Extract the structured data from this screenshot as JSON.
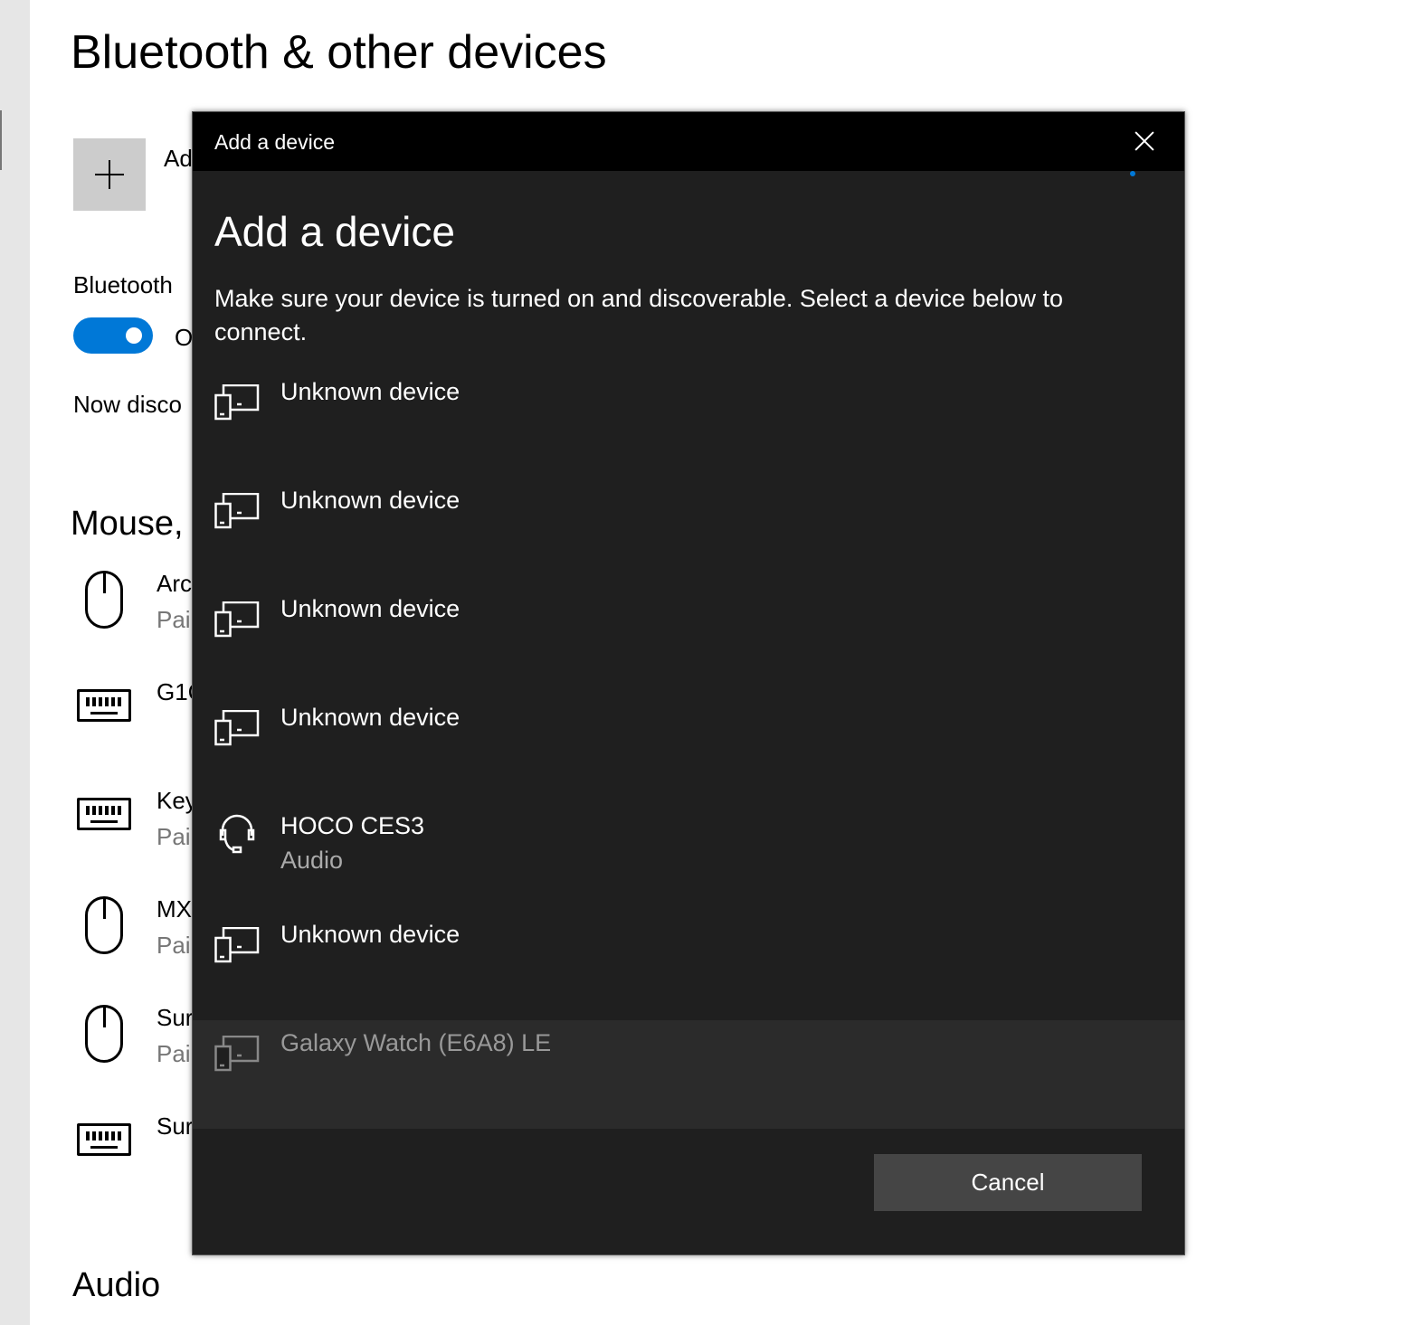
{
  "background": {
    "title": "Bluetooth & other devices",
    "add_label_fragment": "Ad",
    "bluetooth_label": "Bluetooth",
    "toggle_state": "on",
    "toggle_label_fragment": "O",
    "discoverable_fragment": "Now disco",
    "section_mouse_fragment": "Mouse,",
    "items": [
      {
        "icon": "mouse-icon",
        "name": "Arc",
        "status": "Pai"
      },
      {
        "icon": "keyboard-icon",
        "name": "G1C",
        "status": ""
      },
      {
        "icon": "keyboard-icon",
        "name": "Key",
        "status": "Pai"
      },
      {
        "icon": "mouse-icon",
        "name": "MX",
        "status": "Pai"
      },
      {
        "icon": "mouse-icon",
        "name": "Sur",
        "status": "Pai"
      },
      {
        "icon": "keyboard-icon",
        "name": "Sur",
        "status": ""
      }
    ],
    "section_audio": "Audio"
  },
  "dialog": {
    "window_title": "Add a device",
    "heading": "Add a device",
    "description": "Make sure your device is turned on and discoverable. Select a device below to connect.",
    "devices": [
      {
        "icon": "devices-icon",
        "name": "Unknown device",
        "sub": ""
      },
      {
        "icon": "devices-icon",
        "name": "Unknown device",
        "sub": ""
      },
      {
        "icon": "devices-icon",
        "name": "Unknown device",
        "sub": ""
      },
      {
        "icon": "devices-icon",
        "name": "Unknown device",
        "sub": ""
      },
      {
        "icon": "headset-icon",
        "name": "HOCO CES3",
        "sub": "Audio"
      },
      {
        "icon": "devices-icon",
        "name": "Unknown device",
        "sub": ""
      },
      {
        "icon": "devices-icon",
        "name": "Galaxy Watch (E6A8) LE",
        "sub": "",
        "selected": true
      }
    ],
    "cancel_label": "Cancel"
  },
  "colors": {
    "accent": "#0078d7",
    "dialog_bg": "#1f1f1f",
    "titlebar": "#000000",
    "button": "#454545"
  }
}
